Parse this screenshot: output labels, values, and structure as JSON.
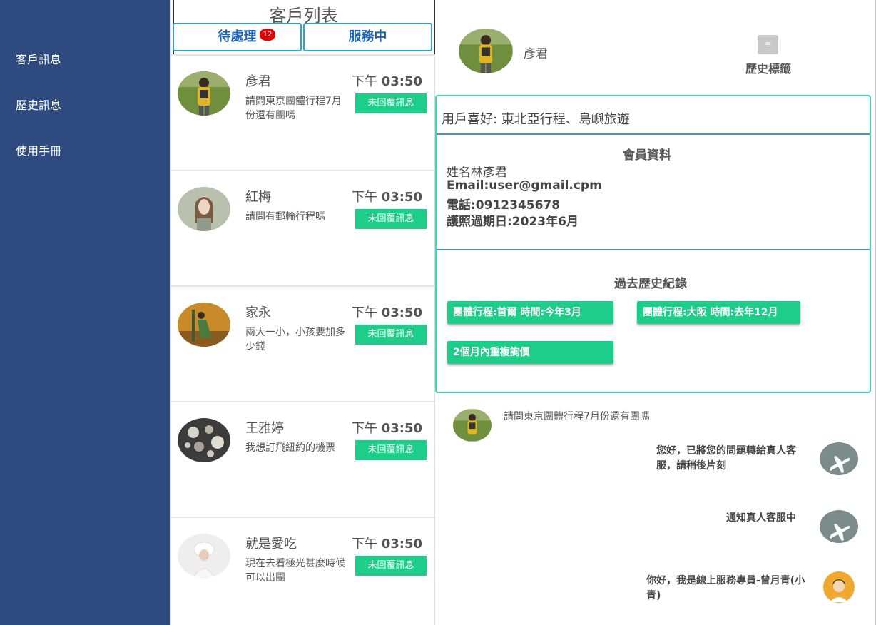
{
  "sidebar": {
    "items": [
      {
        "label": "客戶訊息"
      },
      {
        "label": "歷史訊息"
      },
      {
        "label": "使用手冊"
      }
    ]
  },
  "customer_list": {
    "title": "客戶列表",
    "tabs": {
      "pending": {
        "label": "待處理",
        "badge": "12"
      },
      "serving": {
        "label": "服務中"
      }
    },
    "items": [
      {
        "name": "彥君",
        "time_prefix": "下午",
        "time": "03:50",
        "message": "請問東京團體行程7月份還有團嗎",
        "status": "未回覆訊息"
      },
      {
        "name": "紅梅",
        "time_prefix": "下午",
        "time": "03:50",
        "message": "請問有郵輪行程嗎",
        "status": "未回覆訊息"
      },
      {
        "name": "家永",
        "time_prefix": "下午",
        "time": "03:50",
        "message": "兩大一小，小孩要加多少錢",
        "status": "未回覆訊息"
      },
      {
        "name": "王雅婷",
        "time_prefix": "下午",
        "time": "03:50",
        "message": "我想訂飛紐約的機票",
        "status": "未回覆訊息"
      },
      {
        "name": "就是愛吃",
        "time_prefix": "下午",
        "time": "03:50",
        "message": "現在去看極光甚麼時候可以出團",
        "status": "未回覆訊息"
      }
    ]
  },
  "detail": {
    "name": "彥君",
    "history_tag_icon": "≡",
    "history_tag_label": "歷史標籤",
    "preference": "用戶喜好: 東北亞行程、島嶼旅遊",
    "member": {
      "title": "會員資料",
      "name_line": "姓名林彥君",
      "email_line": "Email:user@gmail.cpm",
      "phone_line": "電話:0912345678",
      "passport_line": "護照過期日:2023年6月"
    },
    "history": {
      "title": "過去歷史紀錄",
      "chips": [
        "團體行程:首爾 時間:今年3月",
        "團體行程:大阪 時間:去年12月",
        "2個月內重複詢價"
      ]
    }
  },
  "chat": {
    "messages": [
      {
        "from": "customer",
        "text": "請問東京團體行程7月份還有團嗎"
      },
      {
        "from": "bot",
        "text": "您好，已將您的問題轉給真人客服，請稍後片刻"
      },
      {
        "from": "bot",
        "text": "通知真人客服中"
      },
      {
        "from": "agent",
        "text": "你好，我是線上服務專員-曾月青(小青)"
      }
    ]
  },
  "colors": {
    "sidebar_bg": "#2e4a7e",
    "status_green": "#1dce8a",
    "tab_blue": "#1f63b6",
    "box_teal": "#3dd6b0",
    "badge_red": "#e60000"
  }
}
